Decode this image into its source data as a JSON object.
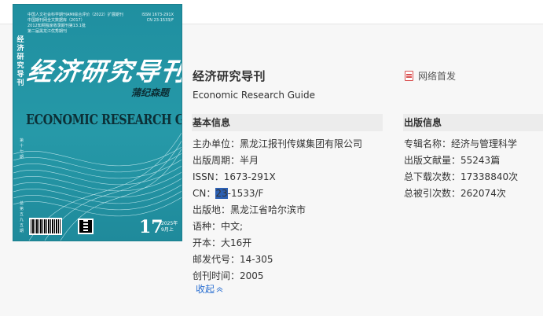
{
  "cover": {
    "top_lines": [
      "中国人文社会科学期刊AMI综合评价（2022）扩展期刊",
      "中国期刊网全文数据库（2017）",
      "2012知网独家收录期刊第13.1批",
      "第二届黑龙江优秀期刊"
    ],
    "issn_lines": [
      "ISSN 1673-291X",
      "CN 23-1533/F"
    ],
    "side_text": "经济研究导刊",
    "title": "经济研究导刊",
    "signature": "蒲纪森题",
    "en_title": "ECONOMIC RESEARCH GUIDE",
    "vert_mid": "第十七期",
    "vert_bottom": "总第五九五期",
    "issue_number": "17",
    "issue_date_line1": "2025年",
    "issue_date_line2": "9月上",
    "colors": {
      "cover_bg": "#2699a8"
    }
  },
  "journal": {
    "title": "经济研究导刊",
    "en_title": "Economic Research Guide",
    "first_pub_label": "网络首发"
  },
  "basic": {
    "heading": "基本信息",
    "fields": [
      {
        "label": "主办单位：",
        "value": "黑龙江报刊传媒集团有限公司"
      },
      {
        "label": "出版周期：",
        "value": "半月"
      },
      {
        "label": "ISSN：",
        "value": "1673-291X"
      },
      {
        "label": "CN：",
        "value_hl": "23",
        "value_rest": "-1533/F"
      },
      {
        "label": "出版地：",
        "value": "黑龙江省哈尔滨市"
      },
      {
        "label": "语种：",
        "value": "中文;"
      },
      {
        "label": "开本：",
        "value": "大16开"
      },
      {
        "label": "邮发代号：",
        "value": "14-305"
      },
      {
        "label": "创刊时间：",
        "value": "2005"
      }
    ],
    "collapse_label": "收起"
  },
  "pub": {
    "heading": "出版信息",
    "fields": [
      {
        "label": "专辑名称：",
        "value": "经济与管理科学"
      },
      {
        "label": "出版文献量：",
        "value": "55243篇"
      },
      {
        "label": "总下载次数：",
        "value": "17338840次"
      },
      {
        "label": "总被引次数：",
        "value": "262074次"
      }
    ]
  },
  "colors": {
    "link": "#2a6fd1",
    "highlight": "#2b5fb3",
    "first_pub_icon": "#d94f4f"
  }
}
